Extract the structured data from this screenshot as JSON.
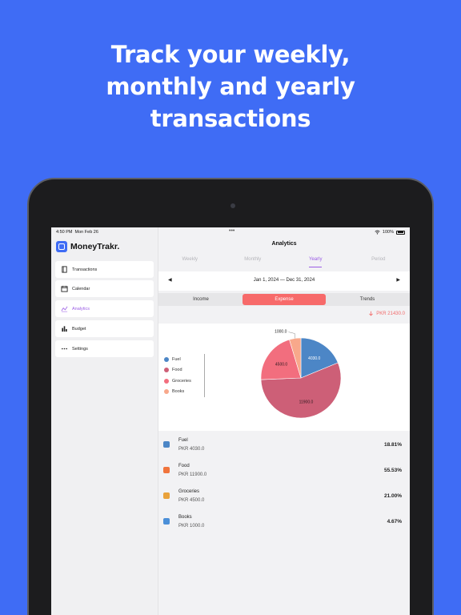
{
  "headline": [
    "Track your weekly,",
    "monthly and yearly",
    "transactions"
  ],
  "status": {
    "time": "4:50 PM",
    "date": "Mon Feb 26",
    "dots": "•••",
    "battery": "100%"
  },
  "brand": {
    "name": "MoneyTrakr."
  },
  "sidebar": {
    "items": [
      {
        "label": "Transactions",
        "icon": "book-icon"
      },
      {
        "label": "Calendar",
        "icon": "calendar-icon"
      },
      {
        "label": "Analytics",
        "icon": "chart-icon",
        "active": true
      },
      {
        "label": "Budget",
        "icon": "bar-chart-icon"
      },
      {
        "label": "Settings",
        "icon": "more-icon"
      }
    ]
  },
  "main": {
    "title": "Analytics",
    "tabs": [
      "Weekly",
      "Monthly",
      "Yearly",
      "Period"
    ],
    "active_tab": "Yearly",
    "date_range": "Jan 1, 2024 — Dec 31, 2024",
    "segments": [
      "Income",
      "Expense",
      "Trends"
    ],
    "active_segment": "Expense",
    "total": "PKR 21430.0"
  },
  "colors": {
    "background": "#3f6cf5",
    "accent": "#9b5de5",
    "expense": "#f76a6a"
  },
  "chart_data": {
    "type": "pie",
    "categories": [
      "Fuel",
      "Food",
      "Groceries",
      "Books"
    ],
    "values": [
      4030.0,
      11900.0,
      4500.0,
      1000.0
    ],
    "labels": [
      "4030.0",
      "11900.0",
      "4500.0",
      "1000.0"
    ],
    "colors": [
      "#4c86c6",
      "#cd5f77",
      "#f26e7e",
      "#f8a88b"
    ],
    "legend": "left"
  },
  "transactions": [
    {
      "name": "Fuel",
      "amount": "PKR 4030.0",
      "percent": "18.81%",
      "icon": "fuel-icon",
      "color": "#4c86c6"
    },
    {
      "name": "Food",
      "amount": "PKR 11900.0",
      "percent": "55.53%",
      "icon": "food-icon",
      "color": "#f0743c"
    },
    {
      "name": "Groceries",
      "amount": "PKR 4500.0",
      "percent": "21.00%",
      "icon": "groceries-icon",
      "color": "#e9a23b"
    },
    {
      "name": "Books",
      "amount": "PKR 1000.0",
      "percent": "4.67%",
      "icon": "books-icon",
      "color": "#4b8fd8"
    }
  ]
}
